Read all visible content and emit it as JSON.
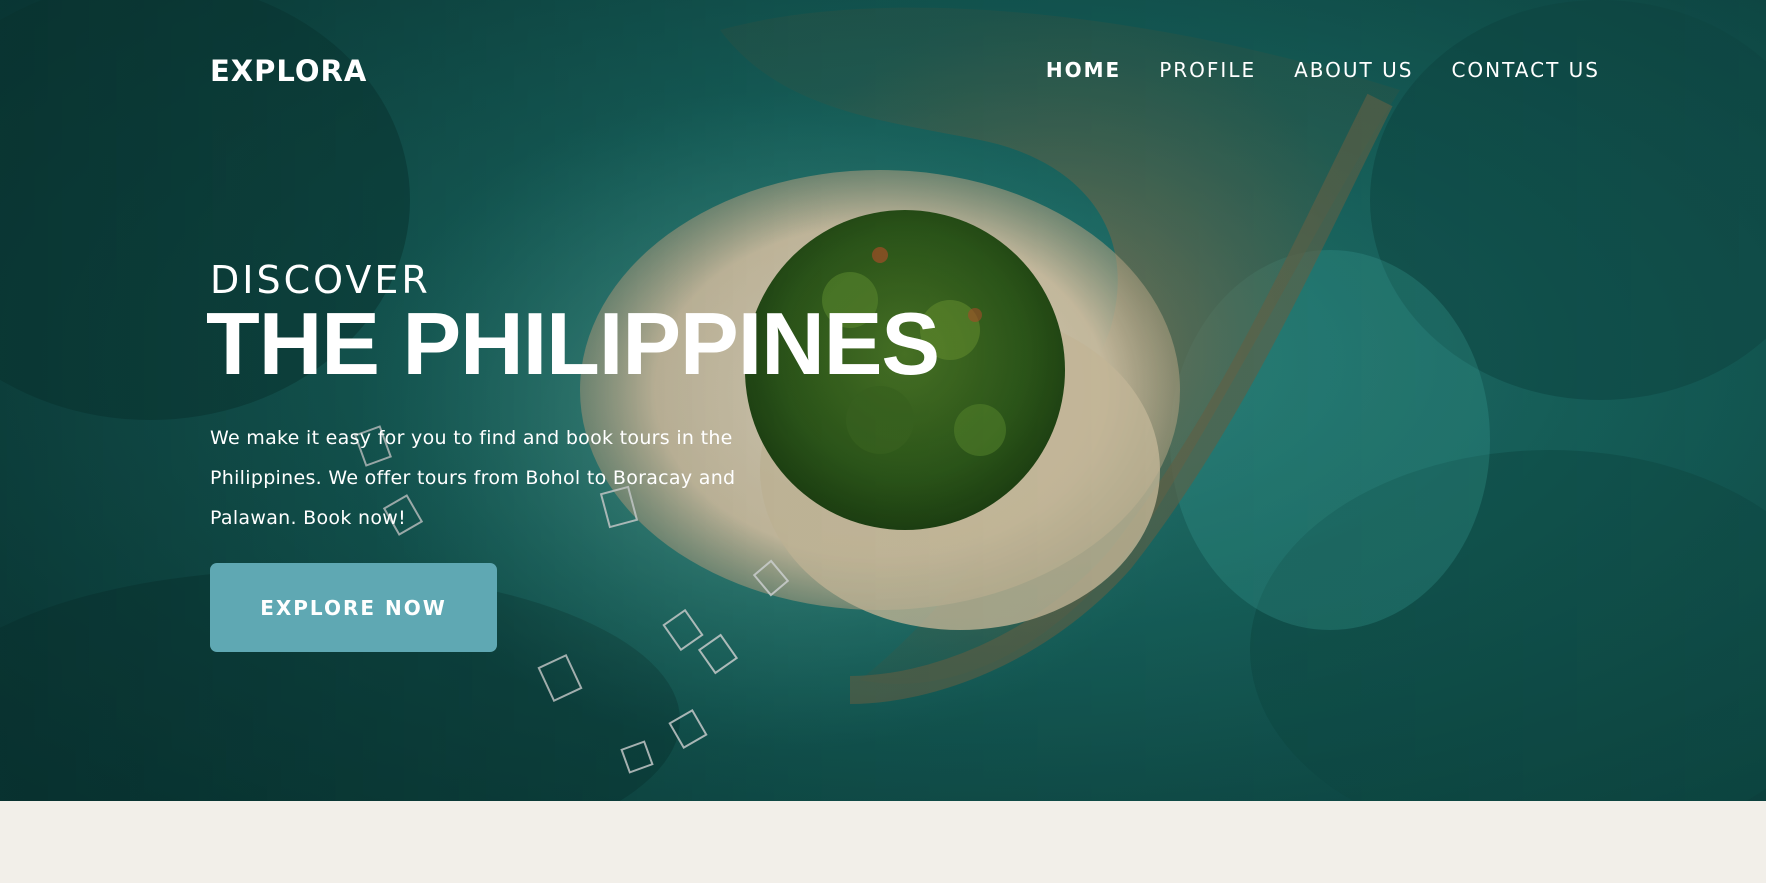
{
  "brand": {
    "logo_text": "EXPLORA"
  },
  "nav": {
    "items": [
      {
        "label": "HOME",
        "active": true
      },
      {
        "label": "PROFILE",
        "active": false
      },
      {
        "label": "ABOUT US",
        "active": false
      },
      {
        "label": "CONTACT US",
        "active": false
      }
    ]
  },
  "hero": {
    "kicker": "DISCOVER",
    "headline": "THE PHILIPPINES",
    "description": "We make it easy for you to find and book tours in the Philippines. We offer tours from Bohol to Boracay and Palawan. Book now!",
    "cta_label": "EXPLORE NOW",
    "background_image": "aerial-island-reef-photo"
  },
  "colors": {
    "cta_background": "#5fa8b3",
    "page_background": "#f2efe9",
    "sea_dark": "#0f4a46",
    "text": "#ffffff"
  }
}
